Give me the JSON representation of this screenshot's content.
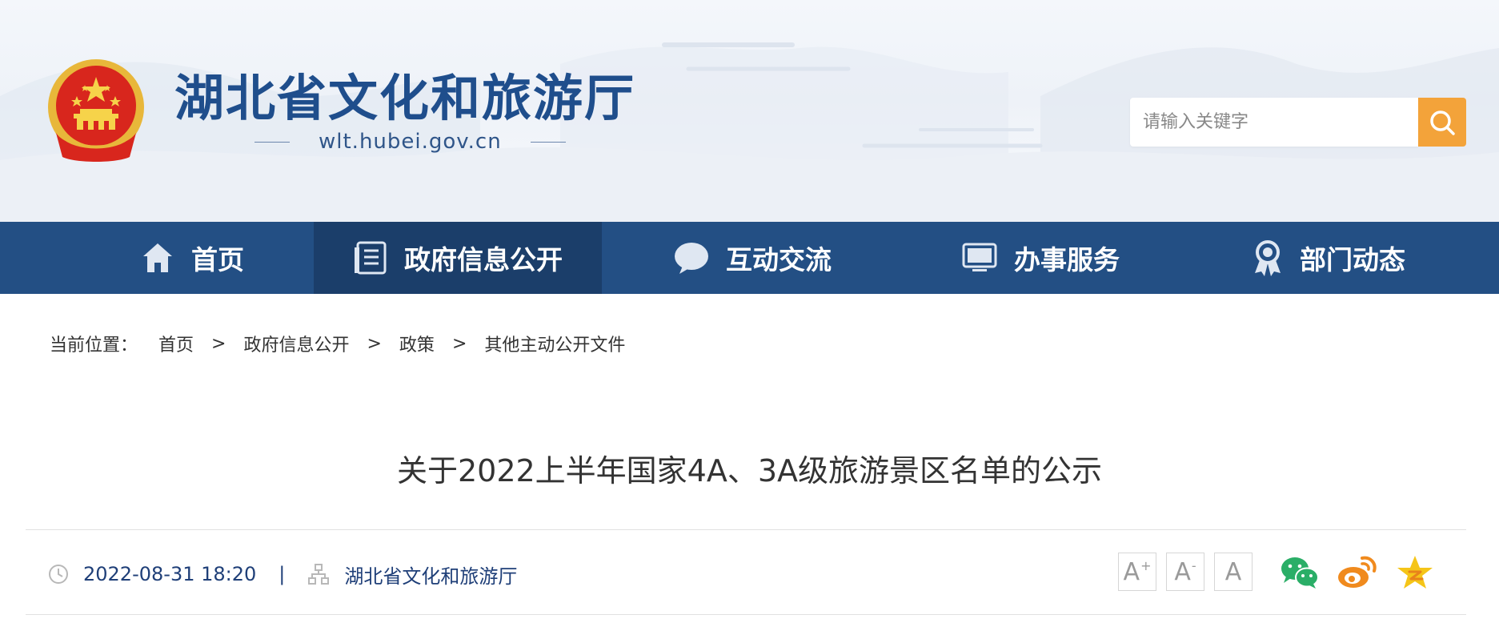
{
  "site": {
    "title": "湖北省文化和旅游厅",
    "domain": "wlt.hubei.gov.cn"
  },
  "search": {
    "placeholder": "请输入关键字"
  },
  "nav": {
    "items": [
      {
        "label": "首页",
        "icon": "home-icon"
      },
      {
        "label": "政府信息公开",
        "icon": "document-list-icon"
      },
      {
        "label": "互动交流",
        "icon": "speech-bubble-icon"
      },
      {
        "label": "办事服务",
        "icon": "monitor-icon"
      },
      {
        "label": "部门动态",
        "icon": "award-ribbon-icon"
      }
    ],
    "active_index": 1
  },
  "breadcrumb": {
    "label": "当前位置：",
    "separator": ">",
    "items": [
      "首页",
      "政府信息公开",
      "政策",
      "其他主动公开文件"
    ]
  },
  "article": {
    "title": "关于2022上半年国家4A、3A级旅游景区名单的公示",
    "datetime": "2022-08-31 18:20",
    "pipe": "|",
    "source": "湖北省文化和旅游厅"
  },
  "tools": {
    "font_larger": "A",
    "font_larger_sup": "+",
    "font_smaller": "A",
    "font_smaller_sup": "-",
    "font_default": "A"
  },
  "colors": {
    "nav_bg": "#234f84",
    "nav_active_bg": "#1b3e6a",
    "search_button": "#f3a33a",
    "title_blue": "#1f4e8c",
    "wechat_green": "#2aae67",
    "weibo_orange": "#f08a1d",
    "qzone_yellow": "#f5c518"
  }
}
